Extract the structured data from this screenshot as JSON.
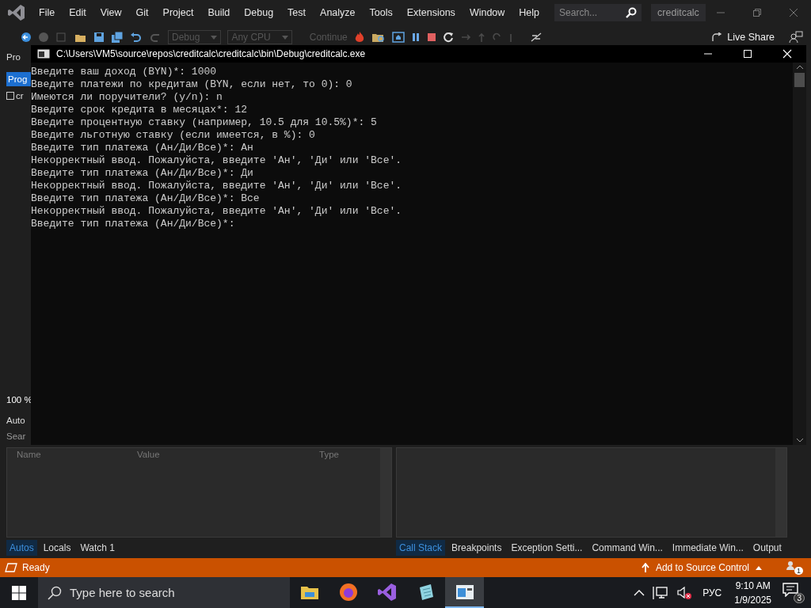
{
  "ide": {
    "app_title": "creditcalc",
    "search_placeholder": "Search...",
    "menu": [
      "File",
      "Edit",
      "View",
      "Git",
      "Project",
      "Build",
      "Debug",
      "Test",
      "Analyze",
      "Tools",
      "Extensions",
      "Window",
      "Help"
    ],
    "toolbar": [
      {
        "kind": "dropdown",
        "label": "Debug",
        "disabled": true
      },
      {
        "kind": "dropdown",
        "label": "Any CPU",
        "disabled": true
      },
      {
        "kind": "play",
        "label": "Continue",
        "disabled": true
      }
    ],
    "live_share": "Live Share",
    "fragments": {
      "explorer_label": "Pro",
      "active_tab": "Prog",
      "project_item": "cr",
      "zoom": "100 %",
      "panel_title": "Auto",
      "search": "Sear"
    },
    "autos": {
      "columns": [
        "Name",
        "Value",
        "Type"
      ],
      "tabs": [
        {
          "label": "Autos",
          "selected": true
        },
        {
          "label": "Locals",
          "selected": false
        },
        {
          "label": "Watch 1",
          "selected": false
        }
      ]
    },
    "debug_tabs": [
      {
        "label": "Call Stack",
        "selected": true
      },
      {
        "label": "Breakpoints",
        "selected": false
      },
      {
        "label": "Exception Setti...",
        "selected": false
      },
      {
        "label": "Command Win...",
        "selected": false
      },
      {
        "label": "Immediate Win...",
        "selected": false
      },
      {
        "label": "Output",
        "selected": false
      }
    ]
  },
  "console": {
    "title": "C:\\Users\\VM5\\source\\repos\\creditcalc\\creditcalc\\bin\\Debug\\creditcalc.exe",
    "lines": [
      "Введите ваш доход (BYN)*: 1000",
      "Введите платежи по кредитам (BYN, если нет, то 0): 0",
      "Имеются ли поручители? (y/n): n",
      "Введите срок кредита в месяцах*: 12",
      "Введите процентную ставку (например, 10.5 для 10.5%)*: 5",
      "Введите льготную ставку (если имеется, в %): 0",
      "Введите тип платежа (Ан/Ди/Все)*: Ан",
      "Некорректный ввод. Пожалуйста, введите 'Ан', 'Ди' или 'Все'.",
      "Введите тип платежа (Ан/Ди/Все)*: Ди",
      "Некорректный ввод. Пожалуйста, введите 'Ан', 'Ди' или 'Все'.",
      "Введите тип платежа (Ан/Ди/Все)*: Все",
      "Некорректный ввод. Пожалуйста, введите 'Ан', 'Ди' или 'Все'.",
      "Введите тип платежа (Ан/Ди/Все)*:"
    ]
  },
  "status_bar": {
    "text": "Ready",
    "source_control": "Add to Source Control",
    "notifications": "1"
  },
  "taskbar": {
    "search_placeholder": "Type here to search",
    "apps": [
      {
        "kind": "folder",
        "selected": false
      },
      {
        "kind": "browser",
        "selected": false
      },
      {
        "kind": "ide",
        "selected": false
      },
      {
        "kind": "editor",
        "selected": false
      },
      {
        "kind": "console",
        "selected": true
      }
    ],
    "language": "РУС",
    "time": "9:10 AM",
    "date": "1/9/2025",
    "notifications": "3"
  }
}
